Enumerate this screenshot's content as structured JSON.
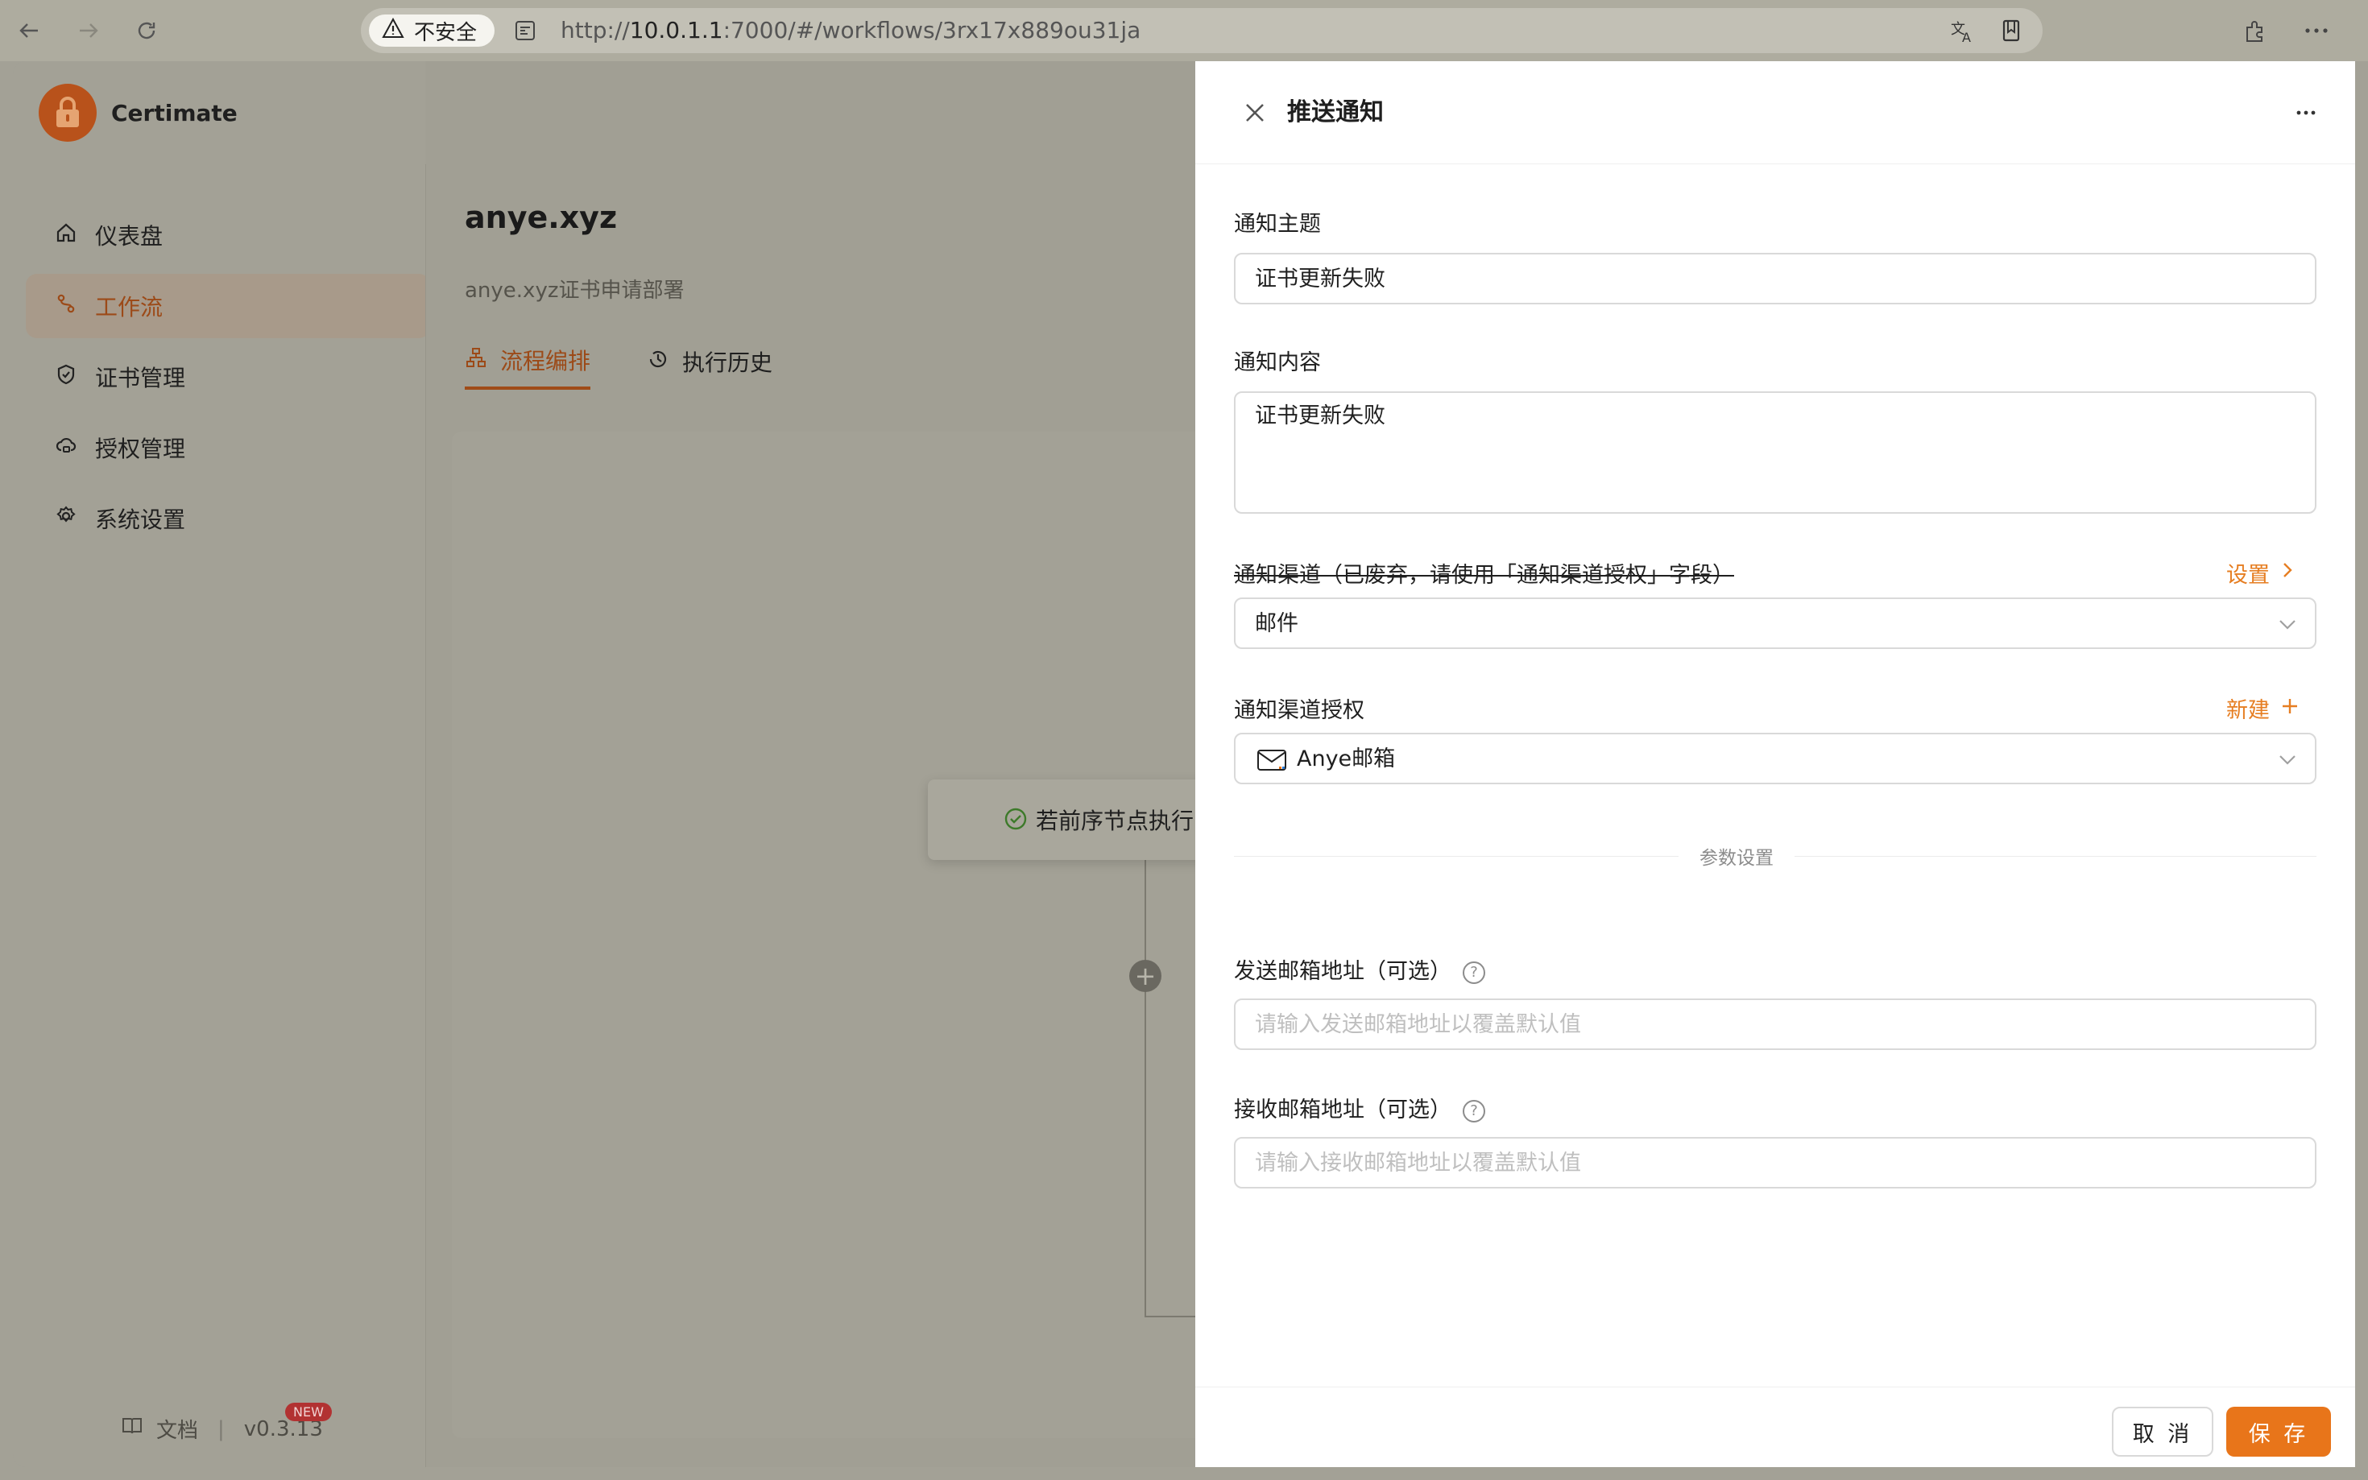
{
  "browser": {
    "security_label": "不安全",
    "url_prefix": "http://",
    "url_host": "10.0.1.1",
    "url_rest": ":7000/#/workflows/3rx17x889ou31ja"
  },
  "sidebar": {
    "brand": "Certimate",
    "items": [
      {
        "label": "仪表盘",
        "icon": "home-icon"
      },
      {
        "label": "工作流",
        "icon": "workflow-icon"
      },
      {
        "label": "证书管理",
        "icon": "shield-check-icon"
      },
      {
        "label": "授权管理",
        "icon": "cloud-lock-icon"
      },
      {
        "label": "系统设置",
        "icon": "gear-icon"
      }
    ],
    "footer": {
      "docs": "文档",
      "version": "v0.3.13",
      "badge": "NEW"
    }
  },
  "main": {
    "title": "anye.xyz",
    "subtitle": "anye.xyz证书申请部署",
    "tabs": [
      {
        "label": "流程编排"
      },
      {
        "label": "执行历史"
      }
    ],
    "canvas": {
      "node_text": "若前序节点执行"
    }
  },
  "drawer": {
    "title": "推送通知",
    "subject": {
      "label": "通知主题",
      "value": "证书更新失败"
    },
    "content": {
      "label": "通知内容",
      "value": "证书更新失败"
    },
    "channel": {
      "label": "通知渠道（已废弃，请使用「通知渠道授权」字段）",
      "action": "设置",
      "value": "邮件"
    },
    "channel_auth": {
      "label": "通知渠道授权",
      "action": "新建",
      "value": "Anye邮箱"
    },
    "section": "参数设置",
    "sender": {
      "label": "发送邮箱地址（可选）",
      "placeholder": "请输入发送邮箱地址以覆盖默认值"
    },
    "receiver": {
      "label": "接收邮箱地址（可选）",
      "placeholder": "请输入接收邮箱地址以覆盖默认值"
    },
    "cancel": "取 消",
    "save": "保 存"
  },
  "colors": {
    "accent": "#e8751a",
    "brand": "#b8521b"
  }
}
